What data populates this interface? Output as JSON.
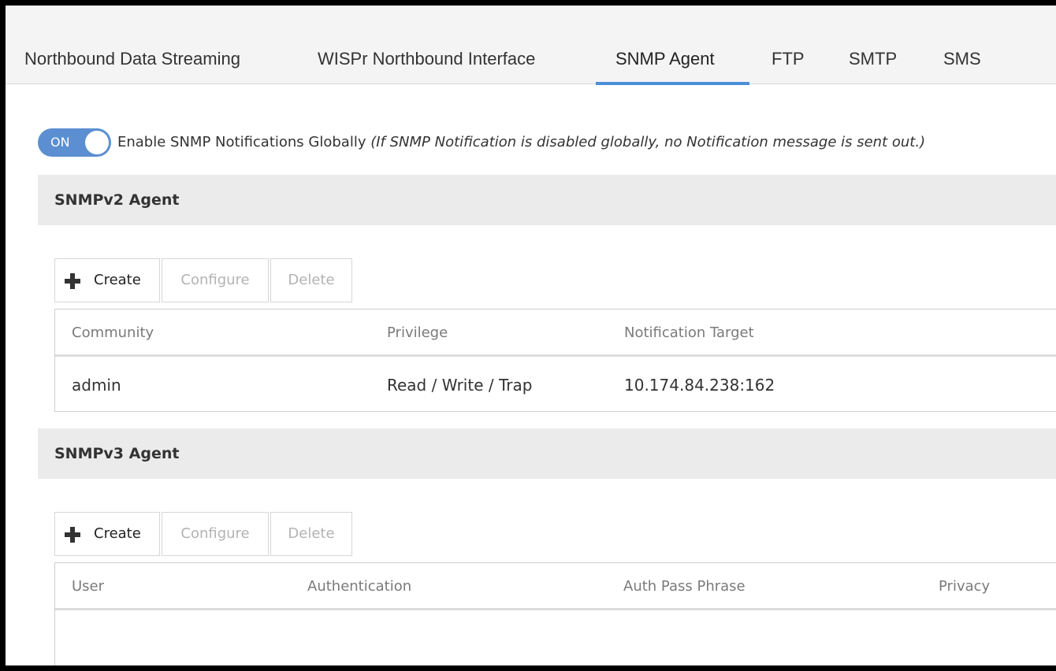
{
  "tabs": [
    {
      "label": "Northbound Data Streaming"
    },
    {
      "label": "WISPr Northbound Interface"
    },
    {
      "label": "SNMP Agent",
      "active": true
    },
    {
      "label": "FTP"
    },
    {
      "label": "SMTP"
    },
    {
      "label": "SMS"
    }
  ],
  "global_toggle": {
    "state": "ON",
    "label": "Enable SNMP Notifications Globally",
    "note": "(If SNMP Notification is disabled globally, no Notification message is sent out.)"
  },
  "snmpv2": {
    "title": "SNMPv2 Agent",
    "buttons": {
      "create": "Create",
      "configure": "Configure",
      "delete": "Delete"
    },
    "columns": [
      "Community",
      "Privilege",
      "Notification Target"
    ],
    "rows": [
      {
        "community": "admin",
        "privilege": "Read / Write / Trap",
        "target": "10.174.84.238:162"
      }
    ]
  },
  "snmpv3": {
    "title": "SNMPv3 Agent",
    "buttons": {
      "create": "Create",
      "configure": "Configure",
      "delete": "Delete"
    },
    "columns": [
      "User",
      "Authentication",
      "Auth Pass Phrase",
      "Privacy"
    ],
    "rows": []
  },
  "colors": {
    "accent": "#4a90d9",
    "toggle_on": "#5b8fd1",
    "section_bg": "#ebebeb",
    "disabled_text": "#b3b3b3"
  },
  "icons": {
    "create": "plus-icon"
  }
}
